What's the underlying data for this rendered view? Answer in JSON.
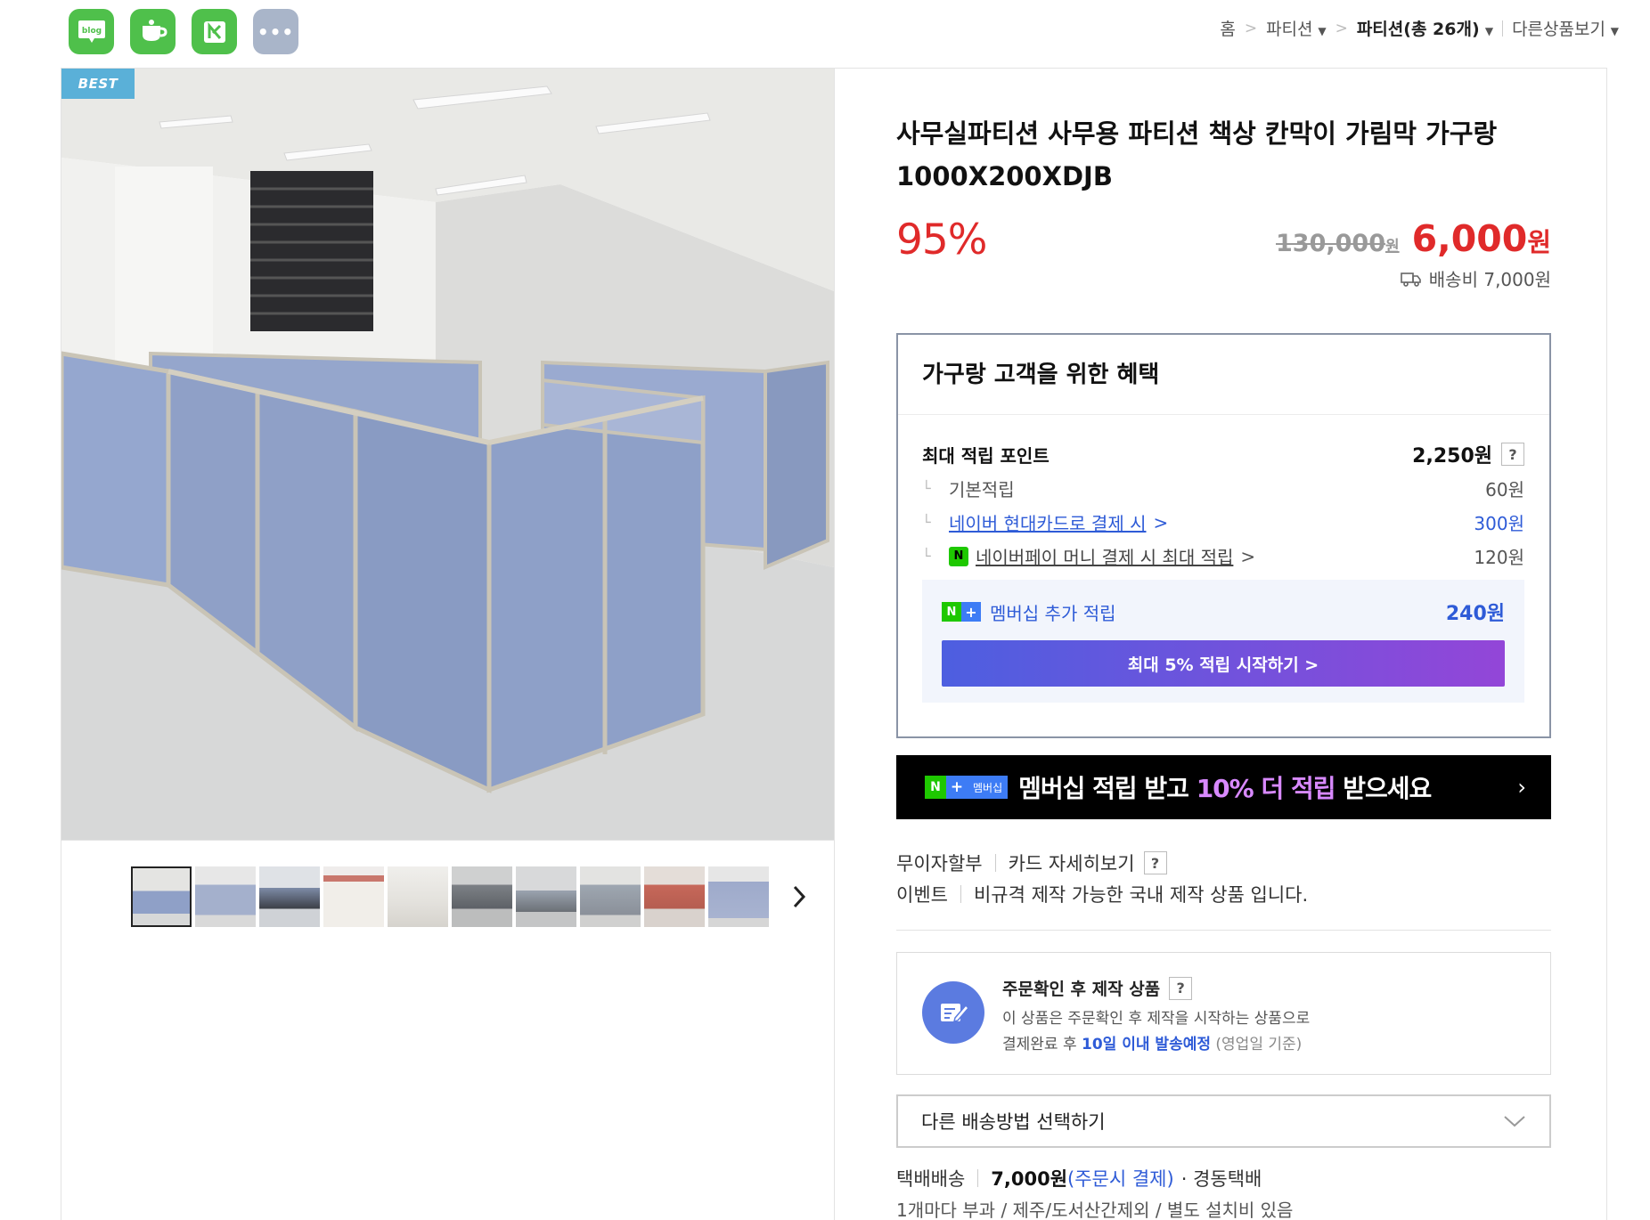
{
  "sns": {
    "blog_label": "blog",
    "more_label": "•••"
  },
  "breadcrumb": {
    "home": "홈",
    "sep": ">",
    "category": "파티션",
    "current": "파티션(총 26개)",
    "other": "다른상품보기"
  },
  "product": {
    "badge": "BEST",
    "title": "사무실파티션 사무용 파티션 책상 칸막이 가림막 가구랑 1000X200XDJB",
    "discount": "95%",
    "original_price": "130,000",
    "original_won": "원",
    "sale_price": "6,000",
    "sale_won": "원",
    "shipping_fee": "배송비 7,000원"
  },
  "benefit": {
    "title": "가구랑 고객을 위한 혜택",
    "max_points_label": "최대 적립 포인트",
    "max_points_value": "2,250원",
    "help": "?",
    "rows": [
      {
        "label": "기본적립",
        "value": "60원"
      },
      {
        "label": "네이버 현대카드로 결제 시",
        "value": "300원"
      },
      {
        "label": "네이버페이 머니 결제 시 최대 적립",
        "value": "120원"
      }
    ],
    "elbow": "└",
    "chevron": ">",
    "npay_icon_text": "N",
    "membership_label": "멤버십 추가 적립",
    "membership_value": "240원",
    "start_button": "최대 5% 적립 시작하기 >"
  },
  "banner": {
    "n": "N",
    "plus": "+",
    "tag": "멤버십",
    "msg_before": "멤버십 적립 받고 ",
    "msg_highlight": "10% 더 적립",
    "msg_after": " 받으세요",
    "arrow": "›"
  },
  "payment": {
    "installment_label": "무이자할부",
    "installment_value": "카드 자세히보기",
    "event_label": "이벤트",
    "event_value": "비규격 제작 가능한 국내 제작 상품 입니다."
  },
  "made_to_order": {
    "title": "주문확인 후 제작 상품",
    "line1": "이 상품은 주문확인 후 제작을 시작하는 상품으로",
    "line2_before": "결제완료 후 ",
    "line2_highlight": "10일 이내 발송예정",
    "line2_after": " (영업일 기준)"
  },
  "shipping": {
    "select_label": "다른 배송방법 선택하기",
    "method": "택배배송",
    "fee": "7,000원",
    "fee_note": "(주문시 결제)",
    "carrier": "· 경동택배",
    "note": "1개마다 부과 / 제주/도서산간제외 / 별도 설치비 있음"
  },
  "colors": {
    "accent_red": "#e02a2a",
    "naver_green": "#1ec800",
    "link_blue": "#2e5bd7"
  }
}
